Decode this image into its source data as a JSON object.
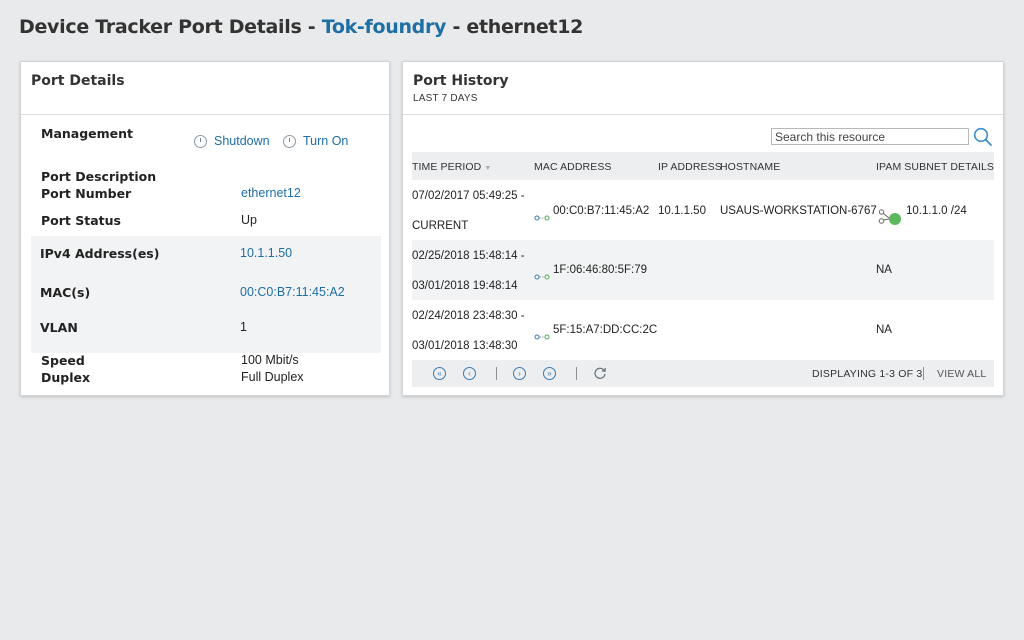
{
  "page": {
    "title_prefix": "Device Tracker Port Details - ",
    "title_device": "Tok-foundry",
    "title_suffix": " - ethernet12"
  },
  "port_details": {
    "title": "Port Details",
    "management_label": "Management",
    "shutdown_label": "Shutdown",
    "turn_on_label": "Turn On",
    "port_description_label": "Port Description",
    "port_number_label": "Port Number",
    "port_number_value": "ethernet12",
    "port_status_label": "Port Status",
    "port_status_value": "Up",
    "ipv4_label": "IPv4 Address(es)",
    "ipv4_value": "10.1.1.50",
    "mac_label": "MAC(s)",
    "mac_value": "00:C0:B7:11:45:A2",
    "vlan_label": "VLAN",
    "vlan_value": "1",
    "speed_label": "Speed",
    "speed_value": "100 Mbit/s",
    "duplex_label": "Duplex",
    "duplex_value": "Full Duplex"
  },
  "port_history": {
    "title": "Port History",
    "subtitle": "LAST 7 DAYS",
    "search_placeholder": "Search this resource",
    "columns": {
      "time_period": "TIME PERIOD",
      "mac_address": "MAC ADDRESS",
      "ip_address": "IP ADDRESS",
      "hostname": "HOSTNAME",
      "ipam": "IPAM SUBNET DETAILS"
    },
    "rows": [
      {
        "time_start": "07/02/2017 05:49:25 -",
        "time_end": "CURRENT",
        "mac": "00:C0:B7:11:45:A2",
        "ip": "10.1.1.50",
        "hostname": "USAUS-WORKSTATION-6767",
        "ipam": "10.1.1.0 /24"
      },
      {
        "time_start": "02/25/2018 15:48:14 -",
        "time_end": "03/01/2018 19:48:14",
        "mac": "1F:06:46:80:5F:79",
        "ip": "",
        "hostname": "",
        "ipam": "NA"
      },
      {
        "time_start": "02/24/2018 23:48:30 -",
        "time_end": "03/01/2018 13:48:30",
        "mac": "5F:15:A7:DD:CC:2C",
        "ip": "",
        "hostname": "",
        "ipam": "NA"
      }
    ],
    "footer": {
      "displaying": "DISPLAYING 1-3 OF 3",
      "view_all": "VIEW ALL"
    }
  }
}
